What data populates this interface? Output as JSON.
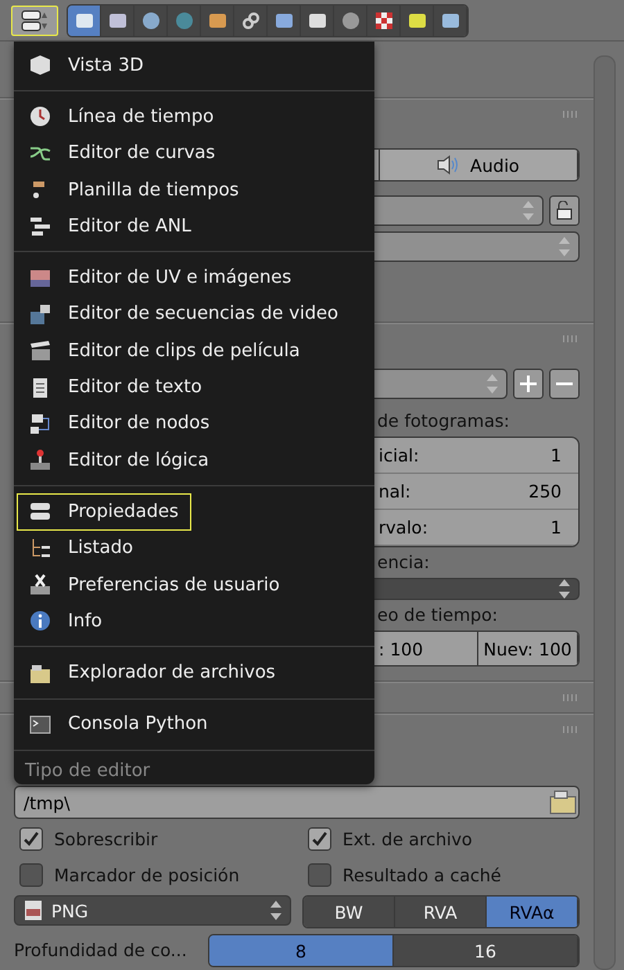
{
  "header": {
    "editor_button": {
      "active": true
    },
    "tabs": [
      {
        "selected": true
      },
      {
        "selected": false
      },
      {
        "selected": false
      },
      {
        "selected": false
      },
      {
        "selected": false
      },
      {
        "selected": false
      },
      {
        "selected": false
      },
      {
        "selected": false
      },
      {
        "selected": false
      },
      {
        "selected": false
      },
      {
        "selected": false
      },
      {
        "selected": false
      }
    ]
  },
  "render": {
    "audio_tab": "Audio"
  },
  "dimensions": {
    "frame_range_label": "de fotogramas:",
    "frame_fields": [
      {
        "label": "icial:",
        "value": "1"
      },
      {
        "label": "nal:",
        "value": "250"
      },
      {
        "label": "rvalo:",
        "value": "1"
      }
    ],
    "frame_rate_label": "encia:",
    "remap_label": "eo de tiempo:",
    "remap_fields": [
      {
        "label": ":",
        "value": "100"
      },
      {
        "label": "Nuev:",
        "value": "100"
      }
    ]
  },
  "output": {
    "path": "/tmp\\",
    "checkboxes": [
      {
        "label": "Sobrescribir",
        "checked": true
      },
      {
        "label": "Ext. de archivo",
        "checked": true
      },
      {
        "label": "Marcador de posición",
        "checked": false
      },
      {
        "label": "Resultado a caché",
        "checked": false
      }
    ],
    "format": "PNG",
    "color_modes": [
      {
        "label": "BW",
        "selected": false
      },
      {
        "label": "RVA",
        "selected": false
      },
      {
        "label": "RVAα",
        "selected": true
      }
    ],
    "depth_label": "Profundidad de co...",
    "depths": [
      {
        "label": "8",
        "selected": true
      },
      {
        "label": "16",
        "selected": false
      }
    ]
  },
  "menu": {
    "groups": [
      [
        {
          "label": "Vista 3D",
          "selected": false
        }
      ],
      [
        {
          "label": "Línea de tiempo",
          "selected": false
        },
        {
          "label": "Editor de curvas",
          "selected": false
        },
        {
          "label": "Planilla de tiempos",
          "selected": false
        },
        {
          "label": "Editor de ANL",
          "selected": false
        }
      ],
      [
        {
          "label": "Editor de UV e imágenes",
          "selected": false
        },
        {
          "label": "Editor de secuencias de video",
          "selected": false
        },
        {
          "label": "Editor de clips de película",
          "selected": false
        },
        {
          "label": "Editor de texto",
          "selected": false
        },
        {
          "label": "Editor de nodos",
          "selected": false
        },
        {
          "label": "Editor de lógica",
          "selected": false
        }
      ],
      [
        {
          "label": "Propiedades",
          "selected": true
        },
        {
          "label": "Listado",
          "selected": false
        },
        {
          "label": "Preferencias de usuario",
          "selected": false
        },
        {
          "label": "Info",
          "selected": false
        }
      ],
      [
        {
          "label": "Explorador de archivos",
          "selected": false
        }
      ],
      [
        {
          "label": "Consola Python",
          "selected": false
        }
      ]
    ],
    "title": "Tipo de editor"
  }
}
